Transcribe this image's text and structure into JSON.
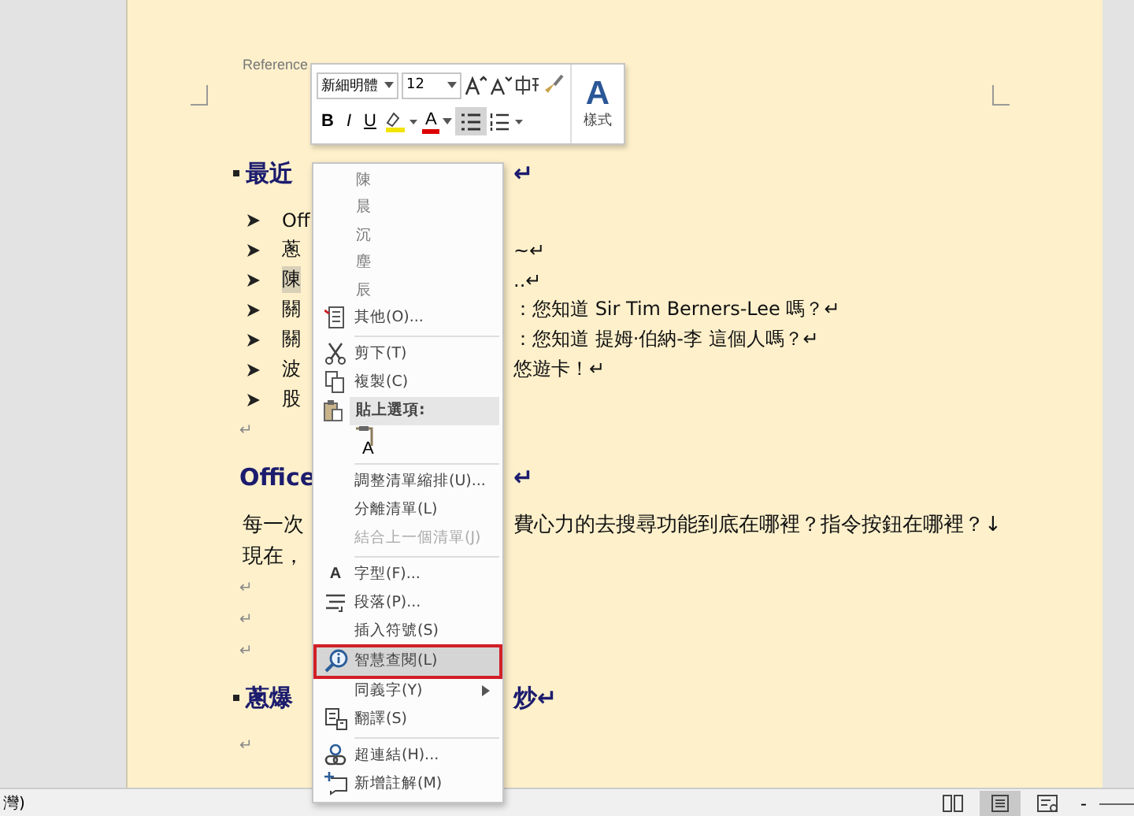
{
  "header": {
    "label": "Reference"
  },
  "document": [
    {
      "kind": "heading",
      "left": "最近",
      "right": "↵"
    },
    {
      "kind": "bullet",
      "left": "Off",
      "highlighted": false
    },
    {
      "kind": "bullet",
      "left": "蔥",
      "right": "~↵",
      "highlighted": false
    },
    {
      "kind": "bullet",
      "left": "陳",
      "right": "..↵",
      "highlighted": true
    },
    {
      "kind": "bullet",
      "left": "關",
      "right": "：您知道 Sir Tim Berners-Lee 嗎？↵",
      "highlighted": false
    },
    {
      "kind": "bullet",
      "left": "關",
      "right": "：您知道 提姆·伯納-李 這個人嗎？↵",
      "highlighted": false
    },
    {
      "kind": "bullet",
      "left": "波",
      "right": "悠遊卡！↵",
      "highlighted": false
    },
    {
      "kind": "bullet",
      "left": "股",
      "highlighted": false
    },
    {
      "kind": "empty",
      "left": "↵"
    },
    {
      "kind": "heading",
      "left": "Office",
      "right": "↵"
    },
    {
      "kind": "text",
      "left": "每一次",
      "right": "費心力的去搜尋功能到底在哪裡？指令按鈕在哪裡？↓"
    },
    {
      "kind": "text",
      "left": "現在，"
    },
    {
      "kind": "empty",
      "left": "↵"
    },
    {
      "kind": "empty",
      "left": "↵"
    },
    {
      "kind": "empty",
      "left": "↵"
    },
    {
      "kind": "heading",
      "left": "蔥爆",
      "right": "炒↵"
    },
    {
      "kind": "empty",
      "left": "↵"
    }
  ],
  "mini_toolbar": {
    "font": "新細明體",
    "size": "12",
    "bold": "B",
    "italic": "I",
    "underline": "U",
    "font_color": "A",
    "styles_letter": "A",
    "styles_label": "樣式",
    "bullets_selected": true
  },
  "context_menu": [
    {
      "kind": "candidate",
      "label": "陳"
    },
    {
      "kind": "candidate",
      "label": "晨"
    },
    {
      "kind": "candidate",
      "label": "沉"
    },
    {
      "kind": "candidate",
      "label": "塵"
    },
    {
      "kind": "candidate",
      "label": "辰"
    },
    {
      "kind": "command",
      "label": "其他(O)...",
      "disabled": false,
      "selected": false,
      "submenu": false
    },
    {
      "kind": "separator"
    },
    {
      "kind": "command",
      "label": "剪下(T)",
      "disabled": false,
      "selected": false,
      "submenu": false
    },
    {
      "kind": "command",
      "label": "複製(C)",
      "disabled": false,
      "selected": false,
      "submenu": false
    },
    {
      "kind": "header",
      "label": "貼上選項:"
    },
    {
      "kind": "paste-option",
      "label": "A"
    },
    {
      "kind": "separator"
    },
    {
      "kind": "command",
      "label": "調整清單縮排(U)...",
      "disabled": false,
      "selected": false,
      "submenu": false
    },
    {
      "kind": "command",
      "label": "分離清單(L)",
      "disabled": false,
      "selected": false,
      "submenu": false
    },
    {
      "kind": "command",
      "label": "結合上一個清單(J)",
      "disabled": true,
      "selected": false,
      "submenu": false
    },
    {
      "kind": "separator"
    },
    {
      "kind": "command",
      "label": "字型(F)...",
      "glyph": "A",
      "disabled": false,
      "selected": false,
      "submenu": false
    },
    {
      "kind": "command",
      "label": "段落(P)...",
      "disabled": false,
      "selected": false,
      "submenu": false
    },
    {
      "kind": "command",
      "label": "插入符號(S)",
      "disabled": false,
      "selected": false,
      "submenu": false
    },
    {
      "kind": "command",
      "label": "智慧查閱(L)",
      "disabled": false,
      "selected": true,
      "submenu": false
    },
    {
      "kind": "command",
      "label": "同義字(Y)",
      "disabled": false,
      "selected": false,
      "submenu": true
    },
    {
      "kind": "command",
      "label": "翻譯(S)",
      "disabled": false,
      "selected": false,
      "submenu": false
    },
    {
      "kind": "separator"
    },
    {
      "kind": "command",
      "label": "超連結(H)...",
      "disabled": false,
      "selected": false,
      "submenu": false
    },
    {
      "kind": "command",
      "label": "新增註解(M)",
      "disabled": false,
      "selected": false,
      "submenu": false
    }
  ],
  "status_bar": {
    "left": "灣)",
    "views": [
      {
        "selected": false
      },
      {
        "selected": true
      },
      {
        "selected": false
      }
    ],
    "zoom_minus": "-"
  }
}
